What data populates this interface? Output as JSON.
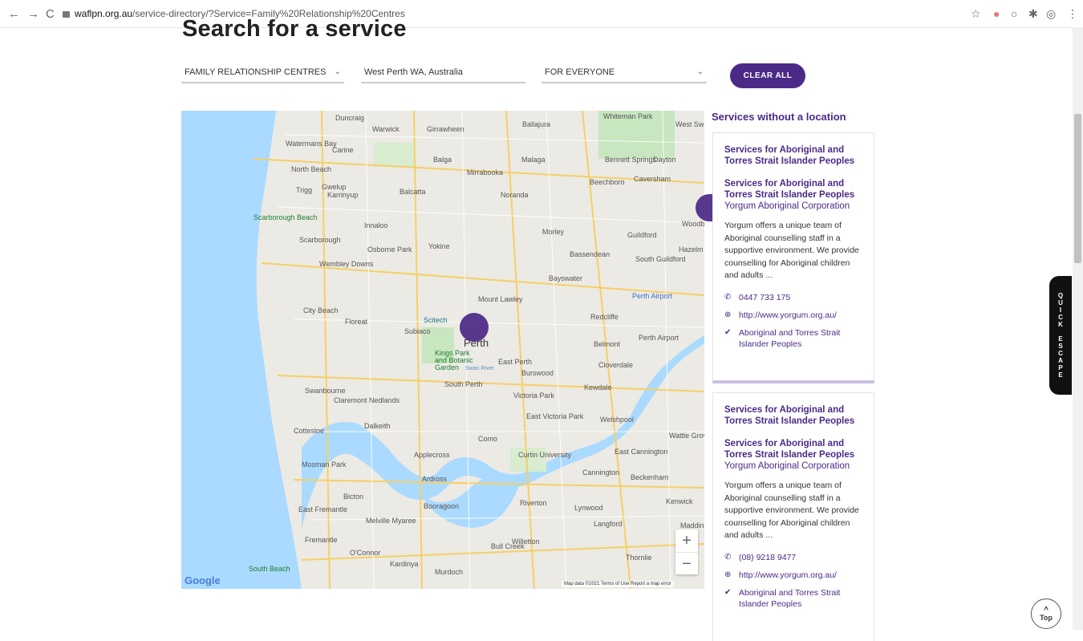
{
  "browser": {
    "url_host": "waflpn.org.au",
    "url_path": "/service-directory/?Service=Family%20Relationship%20Centres"
  },
  "page": {
    "heading": "Search for a service"
  },
  "filters": {
    "service_type": "FAMILY RELATIONSHIP CENTRES",
    "location": "West Perth WA, Australia",
    "audience": "FOR EVERYONE",
    "clear_all": "CLEAR ALL"
  },
  "map": {
    "labels": {
      "perth": "Perth",
      "duncraig": "Duncraig",
      "warwick": "Warwick",
      "girrawheen": "Girrawheen",
      "ballajura": "Ballajura",
      "whiteman_park": "Whiteman Park",
      "west_sw": "West Sw",
      "watermans_bay": "Watermans Bay",
      "carine": "Carine",
      "balga": "Balga",
      "malaga": "Malaga",
      "bennett_springs": "Bennett Springs",
      "dayton": "Dayton",
      "north_beach": "North Beach",
      "mirrabooka": "Mirrabooka",
      "trigg": "Trigg",
      "gwelup": "Gwelup",
      "karrinyup": "Karrinyup",
      "balcatta": "Balcatta",
      "noranda": "Noranda",
      "beechboro": "Beechboro",
      "caversham": "Caversham",
      "scarborough_beach": "Scarborough Beach",
      "innaloo": "Innaloo",
      "scarborough": "Scarborough",
      "morley": "Morley",
      "guildford": "Guildford",
      "osborne_park": "Osborne Park",
      "yokine": "Yokine",
      "bassendean": "Bassendean",
      "south_guildford": "South Guildford",
      "wembley_downs": "Wembley Downs",
      "bayswater": "Bayswater",
      "mount_lawley": "Mount Lawley",
      "perth_airport": "Perth Airport",
      "city_beach": "City Beach",
      "scitech": "Scitech",
      "redcliffe": "Redcliffe",
      "floreat": "Floreat",
      "subiaco": "Subiaco",
      "kings_park": "Kings Park and Botanic Garden",
      "east_perth": "East Perth",
      "belmont": "Belmont",
      "cloverdale": "Cloverdale",
      "swan_river": "Swan River",
      "burswood": "Burswood",
      "south_perth": "South Perth",
      "kewdale": "Kewdale",
      "swanbourne": "Swanbourne",
      "claremont": "Claremont Nedlands",
      "victoria_park": "Victoria Park",
      "east_victoria_park": "East Victoria Park",
      "welshpool": "Welshpool",
      "dalkeith": "Dalkeith",
      "cottesloe": "Cottesloe",
      "como": "Como",
      "wattle_grove": "Wattle Grov",
      "applecross": "Applecross",
      "curtin": "Curtin University",
      "east_cannington": "East Cannington",
      "mosman_park": "Mosman Park",
      "ardross": "Ardross",
      "cannington": "Cannington",
      "beckenham": "Beckenham",
      "bicton": "Bicton",
      "booragoon": "Booragoon",
      "riverton": "Riverton",
      "lynwood": "Lynwood",
      "kenwick": "Kenwick",
      "east_fremantle": "East Fremantle",
      "melville": "Melville Myaree",
      "langford": "Langford",
      "maddington": "Maddingto",
      "fremantle": "Fremantle",
      "bull_creek": "Bull Creek",
      "willetton": "Willetton",
      "oconnor": "O'Connor",
      "thornlie": "Thornlie",
      "kardinya": "Kardinya",
      "south_beach": "South Beach",
      "murdoch": "Murdoch",
      "hazelmere": "Hazelm",
      "woodbridge": "Woodbri"
    },
    "google": "Google",
    "footer": "Map data ©2021   Terms of Use   Report a map error",
    "zoom_in": "+",
    "zoom_out": "−"
  },
  "sidebar": {
    "heading": "Services without a location",
    "cards": [
      {
        "category": "Services for Aboriginal and Torres Strait Islander Peoples",
        "title": "Services for Aboriginal and Torres Strait Islander Peoples",
        "org": "Yorgum Aboriginal Corporation",
        "description": "Yorgum offers a unique team of Aboriginal counselling staff in a supportive environment. We provide counselling for Aboriginal children and adults ...",
        "phone": "0447 733 175",
        "website": "http://www.yorgum.org.au/",
        "tag": "Aboriginal and Torres Strait Islander Peoples"
      },
      {
        "category": "Services for Aboriginal and Torres Strait Islander Peoples",
        "title": "Services for Aboriginal and Torres Strait Islander Peoples",
        "org": "Yorgum Aboriginal Corporation",
        "description": "Yorgum offers a unique team of Aboriginal counselling staff in a supportive environment. We provide counselling for Aboriginal children and adults ...",
        "phone": "(08) 9218 9477",
        "website": "http://www.yorgum.org.au/",
        "tag": "Aboriginal and Torres Strait Islander Peoples"
      }
    ]
  },
  "quick_escape": "QUICK ESCAPE",
  "top_button": "Top",
  "colors": {
    "brand_purple": "#4b2a87",
    "card_border_accent": "#cbbfe0"
  },
  "icons": [
    "back-icon",
    "forward-icon",
    "reload-icon",
    "lock-icon",
    "star-icon",
    "extension-icon",
    "puzzle-icon",
    "profile-icon",
    "menu-icon",
    "phone-icon",
    "globe-icon",
    "check-circle-icon",
    "chevron-down-icon",
    "chevron-up-icon"
  ]
}
